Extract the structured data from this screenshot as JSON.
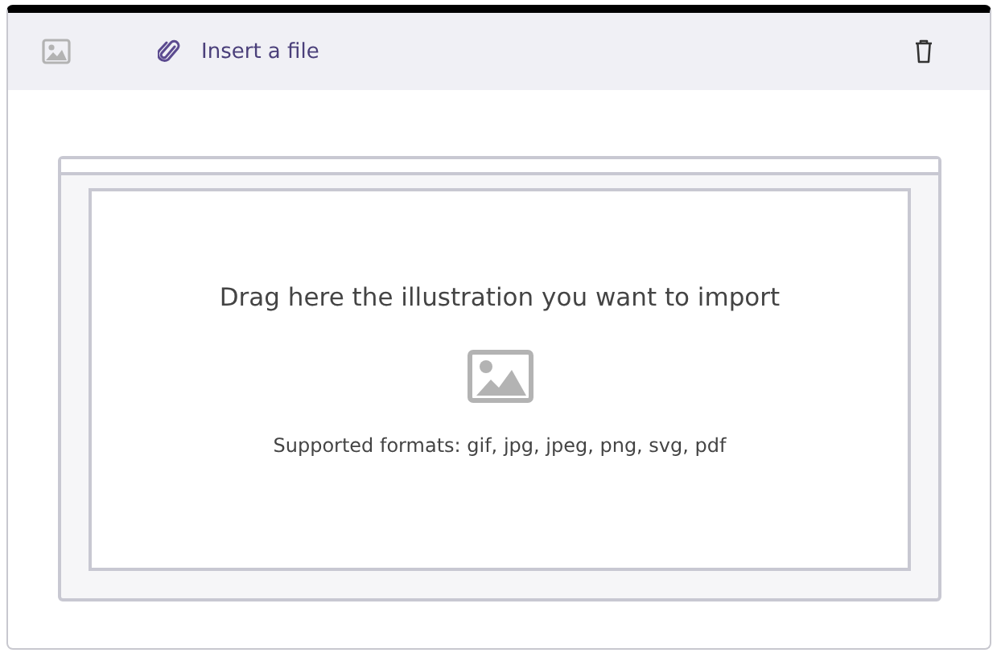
{
  "toolbar": {
    "insert_link": "Insert a file"
  },
  "dropzone": {
    "prompt": "Drag here the illustration you want to import",
    "formats": "Supported formats: gif, jpg, jpeg, png, svg, pdf"
  }
}
